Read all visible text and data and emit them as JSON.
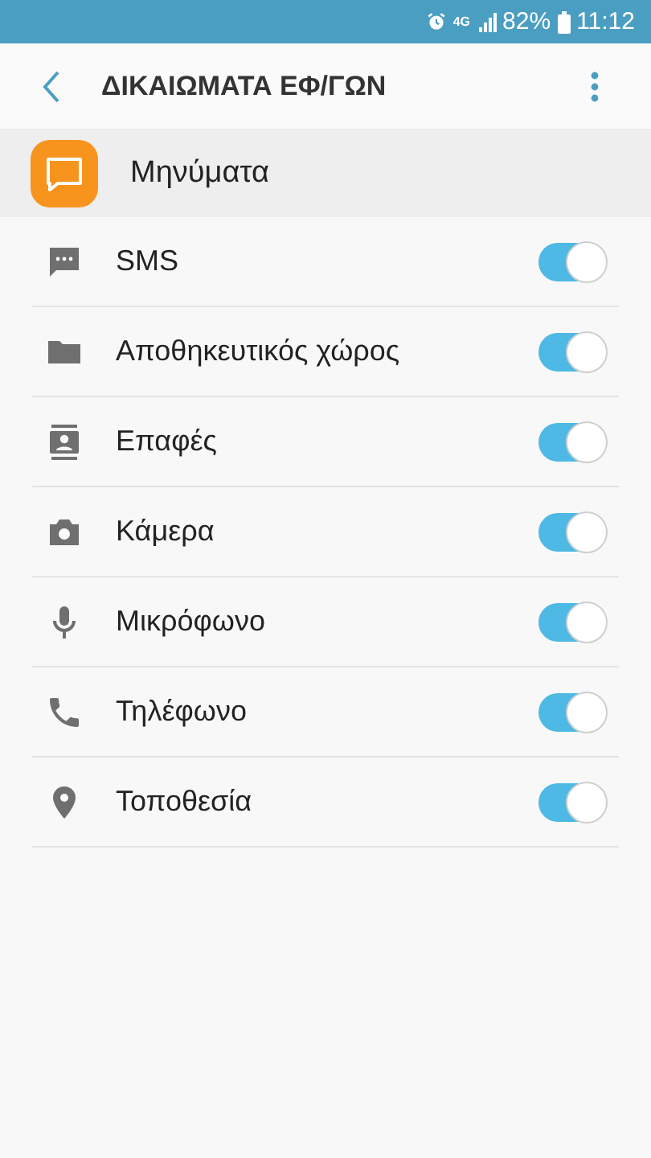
{
  "status_bar": {
    "network": "4G",
    "battery": "82%",
    "time": "11:12"
  },
  "header": {
    "title": "ΔΙΚΑΙΩΜΑΤΑ ΕΦ/ΓΩΝ"
  },
  "app": {
    "name": "Μηνύματα"
  },
  "permissions": [
    {
      "kind": "sms",
      "label": "SMS",
      "on": true
    },
    {
      "kind": "folder",
      "label": "Αποθηκευτικός χώρος",
      "on": true
    },
    {
      "kind": "contacts",
      "label": "Επαφές",
      "on": true
    },
    {
      "kind": "camera",
      "label": "Κάμερα",
      "on": true
    },
    {
      "kind": "mic",
      "label": "Μικρόφωνο",
      "on": true
    },
    {
      "kind": "phone",
      "label": "Τηλέφωνο",
      "on": true
    },
    {
      "kind": "location",
      "label": "Τοποθεσία",
      "on": true
    }
  ]
}
